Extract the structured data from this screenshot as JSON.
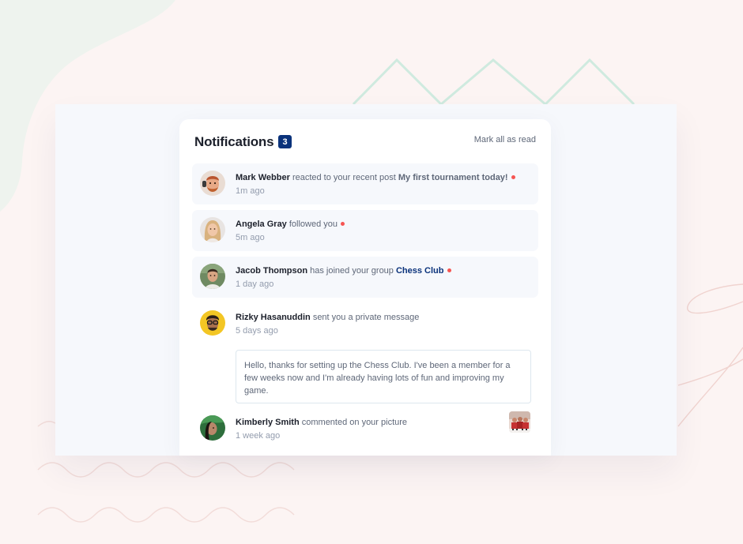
{
  "header": {
    "title": "Notifications",
    "unread_count": "3",
    "mark_all_label": "Mark all as read"
  },
  "notifications": [
    {
      "user": "Mark Webber",
      "action": "reacted to your recent post",
      "target": "My first tournament today!",
      "time": "1m ago",
      "unread": true
    },
    {
      "user": "Angela Gray",
      "action": "followed you",
      "time": "5m ago",
      "unread": true
    },
    {
      "user": "Jacob Thompson",
      "action": "has joined your group",
      "target": "Chess Club",
      "time": "1 day ago",
      "unread": true
    },
    {
      "user": "Rizky Hasanuddin",
      "action": "sent you a private message",
      "time": "5 days ago",
      "message": "Hello, thanks for setting up the Chess Club. I've been a member for a few weeks now and I'm already having lots of fun and improving my game.",
      "unread": false
    },
    {
      "user": "Kimberly Smith",
      "action": "commented on your picture",
      "time": "1 week ago",
      "unread": false
    }
  ],
  "colors": {
    "page_background": "#fcf4f3",
    "stage_background": "#f6f8fc",
    "card_background": "#ffffff",
    "badge_blue": "#0a327b",
    "unread_dot": "#f65552",
    "unread_row_background": "#f6f8fc",
    "heading_text": "#1c202b",
    "body_text": "#5e6778",
    "muted_text": "#939cad"
  }
}
